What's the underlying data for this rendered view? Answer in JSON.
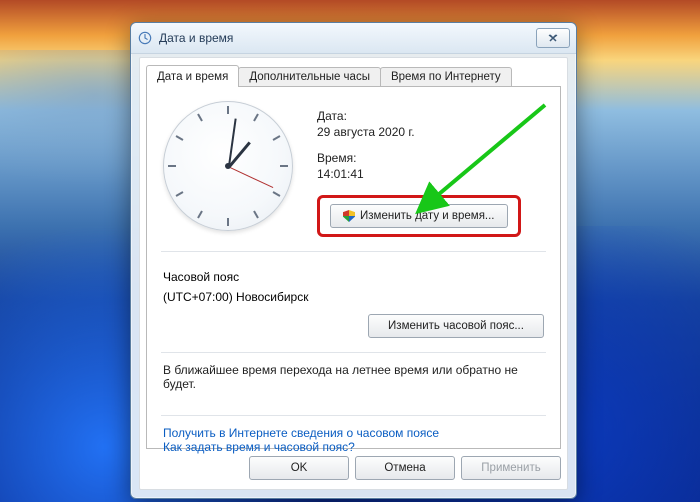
{
  "window": {
    "title": "Дата и время"
  },
  "tabs": {
    "datetime": "Дата и время",
    "additional": "Дополнительные часы",
    "internet": "Время по Интернету"
  },
  "panel": {
    "date_label": "Дата:",
    "date_value": "29 августа 2020 г.",
    "time_label": "Время:",
    "time_value": "14:01:41",
    "change_dt_btn": "Изменить дату и время...",
    "tz_label": "Часовой пояс",
    "tz_value": "(UTC+07:00) Новосибирск",
    "change_tz_btn": "Изменить часовой пояс...",
    "dst_note": "В ближайшее время перехода на летнее время или обратно не будет.",
    "link_tzinfo": "Получить в Интернете сведения о часовом поясе",
    "link_howto": "Как задать время и часовой пояс?"
  },
  "footer": {
    "ok": "OK",
    "cancel": "Отмена",
    "apply": "Применить"
  }
}
